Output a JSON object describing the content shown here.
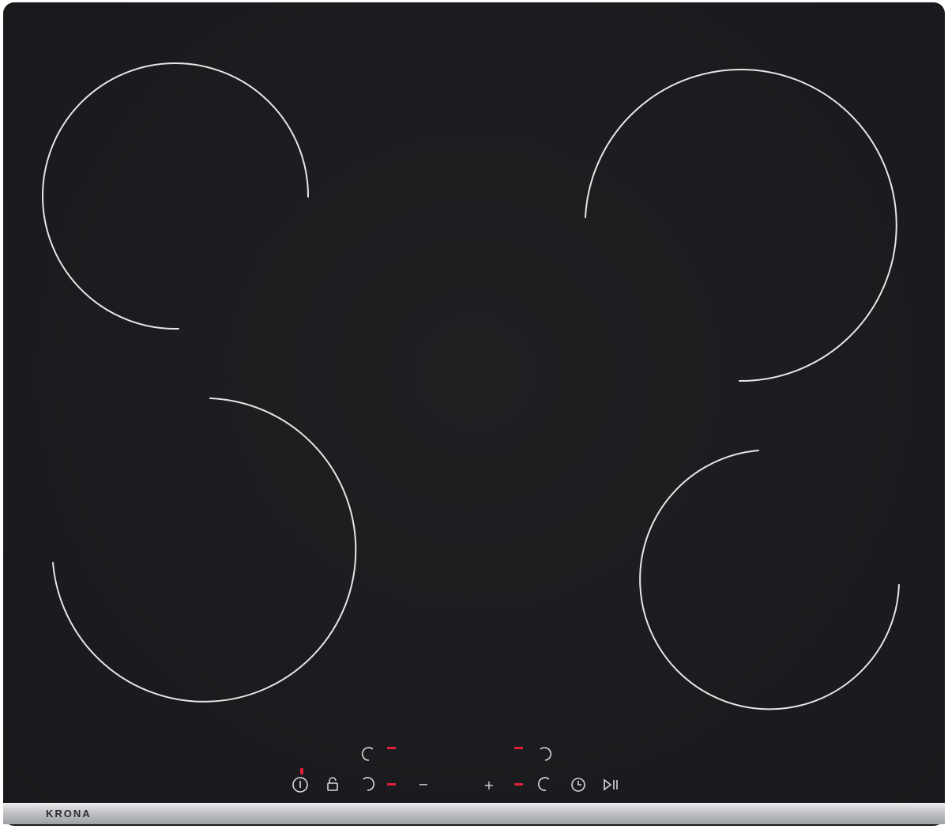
{
  "brand": {
    "name": "KRONA"
  },
  "colors": {
    "glass": "#1b1c1f",
    "ring": "#e8e8e8",
    "indicator": "#e0203c",
    "trim": "#bfc1c4"
  },
  "zones": [
    {
      "name": "rear-left",
      "ring": "split"
    },
    {
      "name": "rear-right",
      "ring": "split"
    },
    {
      "name": "front-left",
      "ring": "split"
    },
    {
      "name": "front-right",
      "ring": "split"
    }
  ],
  "controls": {
    "minus_label": "−",
    "plus_label": "+",
    "icons": [
      "power-icon",
      "lock-icon",
      "zone-select-icon",
      "timer-icon",
      "play-pause-icon"
    ]
  },
  "indicators": {
    "state": "on",
    "power_led": "on"
  }
}
